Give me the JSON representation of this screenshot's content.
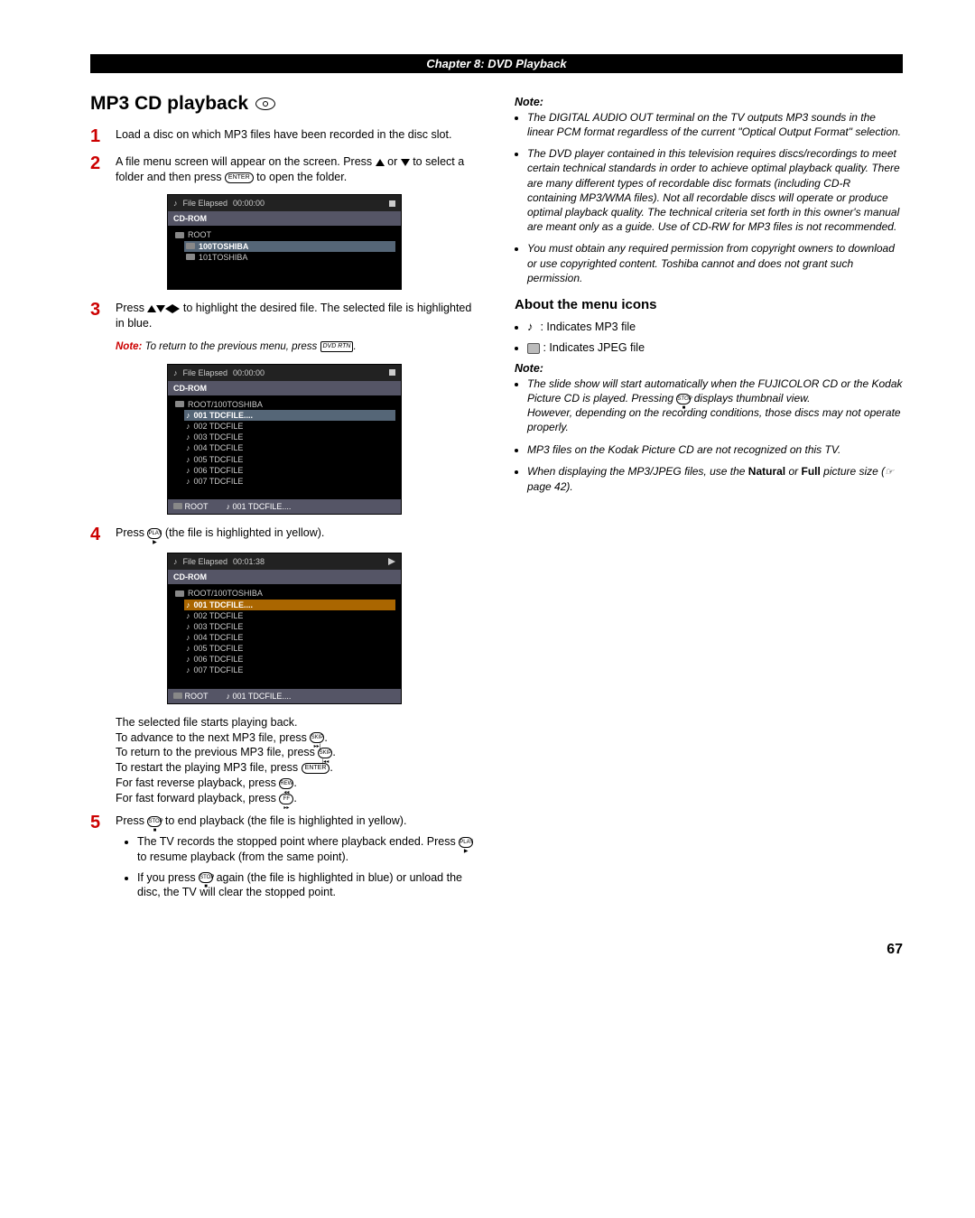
{
  "chapter": "Chapter 8: DVD Playback",
  "title": "MP3 CD playback",
  "steps": {
    "s1": "Load a disc on which MP3 files have been recorded in the disc slot.",
    "s2a": "A file menu screen will appear on the screen. Press ",
    "s2b": " or ",
    "s2c": " to select a folder and then press ",
    "s2d": " to open the folder.",
    "s3a": "Press ",
    "s3b": " to highlight the desired file. The selected file is highlighted in blue.",
    "s4a": "Press ",
    "s4b": " (the file is highlighted in yellow).",
    "s5a": "Press ",
    "s5b": " to end playback (the file is highlighted in yellow)."
  },
  "enter_label": "ENTER",
  "note_return": {
    "label": "Note:",
    "text": "To return to the previous menu, press ",
    "btn": "DVD RTN"
  },
  "osd": {
    "file_elapsed": "File Elapsed",
    "t0": "00:00:00",
    "t1": "00:01:38",
    "cdrom": "CD-ROM",
    "root": "ROOT",
    "folders": [
      "100TOSHIBA",
      "101TOSHIBA"
    ],
    "root_path": "ROOT/100TOSHIBA",
    "files": [
      "001 TDCFILE....",
      "002 TDCFILE",
      "003 TDCFILE",
      "004 TDCFILE",
      "005 TDCFILE",
      "006 TDCFILE",
      "007 TDCFILE"
    ],
    "foot_root": "ROOT",
    "foot_file": "001 TDCFILE...."
  },
  "play_para": {
    "l1": "The selected file starts playing back.",
    "l2a": "To advance to the next MP3 file, press ",
    "l3a": "To return to the previous MP3 file, press ",
    "l4a": "To restart the playing MP3 file, press ",
    "l5a": "For fast reverse playback, press ",
    "l6a": "For fast forward playback, press "
  },
  "btns": {
    "skip_f": "SKIP",
    "skip_b": "SKIP",
    "rew": "REW",
    "ff": "FF",
    "play": "PLAY",
    "stop": "STOP"
  },
  "s5_bullets": {
    "b1a": "The TV records the stopped point where playback ended. Press ",
    "b1b": " to resume playback (from the same point).",
    "b2a": "If you press ",
    "b2b": " again (the file is highlighted in blue) or unload the disc, the TV will clear the stopped point."
  },
  "right": {
    "note_head": "Note:",
    "n1": "The DIGITAL AUDIO OUT terminal on the TV outputs MP3 sounds in the linear PCM format regardless of the current \"Optical Output Format\" selection.",
    "n2": "The DVD player contained in this television requires discs/recordings to meet certain technical standards in order to achieve optimal playback quality. There are many different types of recordable disc formats (including CD-R containing MP3/WMA files). Not all recordable discs will operate or produce optimal playback quality. The technical criteria set forth in this owner's manual are meant only as a guide. Use of CD-RW for MP3 files is not recommended.",
    "n3": "You must obtain any required permission from copyright owners to download or use copyrighted content. Toshiba cannot and does not grant such permission.",
    "about_head": "About the menu icons",
    "mp3_label": ": Indicates MP3 file",
    "jpeg_label": ": Indicates JPEG file",
    "note2_head": "Note:",
    "m1a": "The slide show will start automatically when the FUJICOLOR CD or the Kodak Picture CD is played. Pressing ",
    "m1b": " displays thumbnail view.",
    "m1c": "However, depending on the recording conditions, those discs may not operate properly.",
    "m2": "MP3 files on the Kodak Picture CD are not recognized on this TV.",
    "m3a": "When displaying the MP3/JPEG files, use the ",
    "m3_nat": "Natural",
    "m3_or": " or ",
    "m3_full": "Full",
    "m3b": " picture size (",
    "m3c": " page 42)."
  },
  "page_num": "67"
}
